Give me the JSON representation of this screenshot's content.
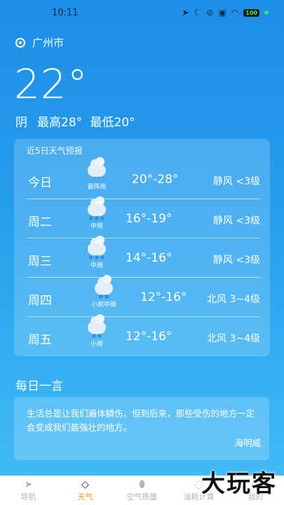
{
  "status": {
    "time": "10:11",
    "battery": "100"
  },
  "location": "广州市",
  "current": {
    "temp": "22°",
    "condition": "阴",
    "high": "最高28°",
    "low": "最低20°"
  },
  "forecast": {
    "title": "近5日天气预报",
    "days": [
      {
        "day": "今日",
        "label": "雷阵雨",
        "range": "20°-28°",
        "wind": "静风 <3级"
      },
      {
        "day": "周二",
        "label": "中雨",
        "range": "16°-19°",
        "wind": "静风 <3级"
      },
      {
        "day": "周三",
        "label": "中雨",
        "range": "14°-16°",
        "wind": "静风 <3级"
      },
      {
        "day": "周四",
        "label": "小到中雨",
        "range": "12°-16°",
        "wind": "北风 3~4级"
      },
      {
        "day": "周五",
        "label": "小雨",
        "range": "12°-16°",
        "wind": "北风 3~4级"
      }
    ]
  },
  "quote": {
    "heading": "每日一言",
    "text": "生活总是让我们遍体鳞伤，但到后来，那些受伤的地方一定会变成我们最强壮的地方。",
    "author": "海明威"
  },
  "tabs": [
    {
      "label": "导航",
      "icon": "navigation-arrow-icon"
    },
    {
      "label": "天气",
      "icon": "water-drop-icon"
    },
    {
      "label": "空气质量",
      "icon": "egg-icon"
    },
    {
      "label": "油耗计算",
      "icon": "leaf-icon"
    },
    {
      "label": "我的",
      "icon": "profile-icon"
    }
  ],
  "watermark": "大玩客",
  "colors": {
    "accent": "#f29d1a",
    "background": "#1e8ee6"
  }
}
